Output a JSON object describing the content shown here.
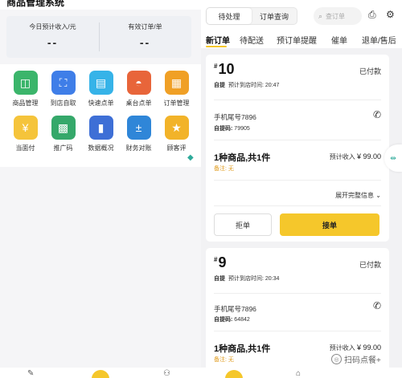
{
  "left": {
    "top_title": "商品管理系统",
    "stats": [
      {
        "label": "今日预计收入/元",
        "value": "--"
      },
      {
        "label": "有效订单/单",
        "value": "--"
      }
    ],
    "grid": [
      {
        "label": "商品管理",
        "icon": "shopping-bag-icon",
        "color": "#3bb56b",
        "glyph": "◫"
      },
      {
        "label": "到店自取",
        "icon": "scan-icon",
        "color": "#3f7ee8",
        "glyph": "⛶"
      },
      {
        "label": "快速点单",
        "icon": "basket-icon",
        "color": "#36b3e8",
        "glyph": "▤"
      },
      {
        "label": "桌台点单",
        "icon": "dish-cover-icon",
        "color": "#e8653a",
        "glyph": "◓"
      },
      {
        "label": "订单管理",
        "icon": "order-box-icon",
        "color": "#f0a026",
        "glyph": "▦"
      },
      {
        "label": "当面付",
        "icon": "yen-coin-icon",
        "color": "#f5c43b",
        "glyph": "¥"
      },
      {
        "label": "推广码",
        "icon": "qr-code-icon",
        "color": "#35a86a",
        "glyph": "▩"
      },
      {
        "label": "数据概况",
        "icon": "bar-chart-icon",
        "color": "#3e6fd6",
        "glyph": "▮"
      },
      {
        "label": "财务对账",
        "icon": "calculator-icon",
        "color": "#2f86d8",
        "glyph": "±"
      },
      {
        "label": "顾客评",
        "icon": "star-icon",
        "color": "#f2b329",
        "glyph": "★"
      }
    ]
  },
  "right": {
    "segments": [
      "待处理",
      "订单查询"
    ],
    "search_placeholder": "查订单",
    "tabs": [
      "新订单",
      "待配送",
      "预订单提醒",
      "催单",
      "退单/售后"
    ],
    "orders": [
      {
        "num": "10",
        "status": "已付款",
        "type": "自提",
        "time_label": "预计到店时间:",
        "time": "20:47",
        "phone": "手机尾号7896",
        "code_label": "自提码:",
        "code": "79905",
        "goods": "1种商品,共1件",
        "income_label": "预计收入",
        "income": "¥ 99.00",
        "note_label": "备注:",
        "note": "无",
        "expand": "展开完整信息",
        "reject": "拒单",
        "accept": "接单"
      },
      {
        "num": "9",
        "status": "已付款",
        "type": "自提",
        "time_label": "预计到店时间:",
        "time": "20:34",
        "phone": "手机尾号7896",
        "code_label": "自提码:",
        "code": "64842",
        "goods": "1种商品,共1件",
        "income_label": "预计收入",
        "income": "¥ 99.00",
        "note_label": "备注:",
        "note": "无"
      }
    ],
    "watermark": "扫码点餐+"
  }
}
